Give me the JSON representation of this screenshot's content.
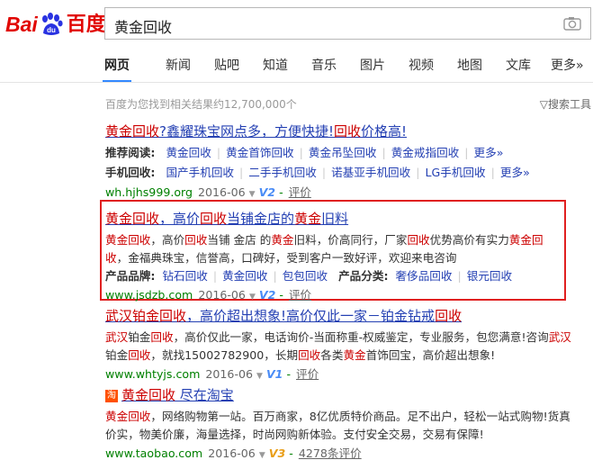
{
  "header": {
    "logo_bai": "Bai",
    "logo_du": "du",
    "logo_cn": "百度",
    "search_value": "黄金回收",
    "camera_icon": "camera-icon"
  },
  "tabs": [
    "网页",
    "新闻",
    "贴吧",
    "知道",
    "音乐",
    "图片",
    "视频",
    "地图",
    "文库",
    "更多»"
  ],
  "count_text": "百度为您找到相关结果约12,700,000个",
  "search_tools": "▽搜索工具",
  "r1": {
    "title_a": "黄金回收",
    "title_b": "?鑫耀珠宝网点多，方便快捷!",
    "title_c": "回收",
    "title_d": "价格高!",
    "row1_label": "推荐阅读:",
    "row1_links": [
      "黄金回收",
      "黄金首饰回收",
      "黄金吊坠回收",
      "黄金戒指回收",
      "更多»"
    ],
    "row2_label": "手机回收:",
    "row2_links": [
      "国产手机回收",
      "二手手机回收",
      "诺基亚手机回收",
      "LG手机回收",
      "更多»"
    ],
    "url": "wh.hjhs999.org",
    "date": "2016-06",
    "badge": "V2",
    "eval": "评价"
  },
  "r2": {
    "title_1": "黄金回收",
    "title_2": "，高价",
    "title_3": "回收",
    "title_4": "当铺金店的",
    "title_5": "黄金",
    "title_6": "旧料",
    "line1_a": "黄金回收",
    "line1_b": "，高价",
    "line1_c": "回收",
    "line1_d": "当铺 金店 的",
    "line1_e": "黄金",
    "line1_f": "旧料，价高同行，厂家",
    "line1_g": "回收",
    "line1_h": "优势高价有实力",
    "line1_i": "黄金回",
    "line2_a": "收",
    "line2_b": "，金福典珠宝，信誉高，口碑好，受到客户一致好评，欢迎来电咨询",
    "cat_label1": "产品品牌:",
    "cat_links1": [
      "钻石回收",
      "黄金回收",
      "包包回收"
    ],
    "cat_label2": "产品分类:",
    "cat_links2": [
      "奢侈品回收",
      "银元回收"
    ],
    "url": "www.jsdzb.com",
    "date": "2016-06",
    "badge": "V2",
    "eval": "评价"
  },
  "r3": {
    "title_1": "武汉",
    "title_2": "铂金",
    "title_3": "回收",
    "title_4": "，高价超出想象!高价仅此一家－铂金钻戒",
    "title_5": "回收",
    "s1_a": "武汉",
    "s1_b": "铂金",
    "s1_c": "回收",
    "s1_d": "，高价仅此一家，电话询价-当面称重-权威鉴定，专业服务，包您满意!咨询",
    "s1_e": "武汉",
    "s2_a": "铂金",
    "s2_b": "回收",
    "s2_c": "，就找15002782900，长期",
    "s2_d": "回收",
    "s2_e": "各类",
    "s2_f": "黄金",
    "s2_g": "首饰回宝，高价超出想象!",
    "url": "www.whtyjs.com",
    "date": "2016-06",
    "badge": "V1",
    "eval": "评价"
  },
  "r4": {
    "icon_text": "淘",
    "title_1": "黄金回收",
    "title_2": " 尽在淘宝",
    "s1_a": "黄金回收",
    "s1_b": "，网络购物第一站。百万商家，8亿优质特价商品。足不出户，轻松一站式购物!货真",
    "s2": "价实，物美价廉，海量选择，时尚网购新体验。支付安全交易，交易有保障!",
    "url": "www.taobao.com",
    "date": "2016-06",
    "badge": "V3",
    "eval": "4278条评价"
  }
}
